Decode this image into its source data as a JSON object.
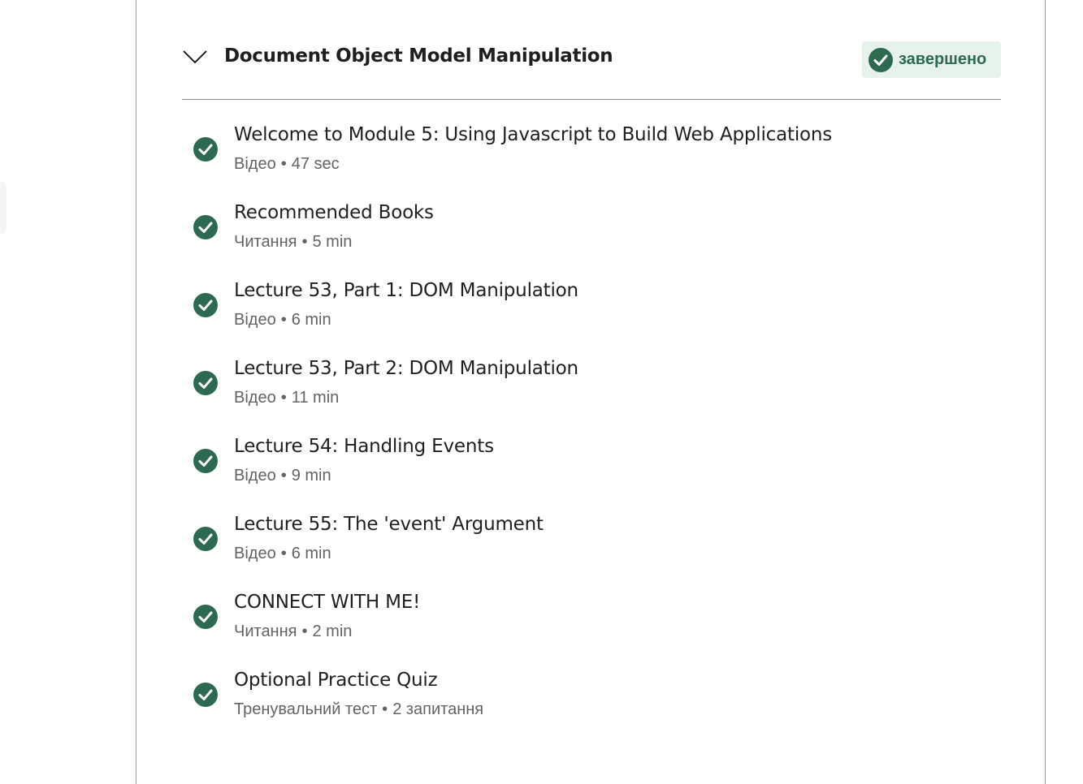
{
  "module": {
    "title": "Document Object Model Manipulation",
    "status_label": "завершено",
    "colors": {
      "accent": "#2d6a4f",
      "badge_bg": "#e6f2ea"
    }
  },
  "items": [
    {
      "title": "Welcome to Module 5: Using Javascript to Build Web Applications",
      "type": "Відео",
      "sep": "•",
      "duration": "47 sec",
      "icon": "check-circle-icon"
    },
    {
      "title": "Recommended Books",
      "type": "Читання",
      "sep": "•",
      "duration": "5 min",
      "icon": "check-circle-icon"
    },
    {
      "title": "Lecture 53, Part 1: DOM Manipulation",
      "type": "Відео",
      "sep": "•",
      "duration": "6 min",
      "icon": "check-circle-icon"
    },
    {
      "title": "Lecture 53, Part 2: DOM Manipulation",
      "type": "Відео",
      "sep": "•",
      "duration": "11 min",
      "icon": "check-circle-icon"
    },
    {
      "title": "Lecture 54: Handling Events",
      "type": "Відео",
      "sep": "•",
      "duration": "9 min",
      "icon": "check-circle-icon"
    },
    {
      "title": "Lecture 55: The 'event' Argument",
      "type": "Відео",
      "sep": "•",
      "duration": "6 min",
      "icon": "check-circle-icon"
    },
    {
      "title": "CONNECT WITH ME!",
      "type": "Читання",
      "sep": "•",
      "duration": "2 min",
      "icon": "check-circle-icon"
    },
    {
      "title": "Optional Practice Quiz",
      "type": "Тренувальний тест",
      "sep": "•",
      "duration": "2 запитання",
      "icon": "check-circle-icon"
    }
  ]
}
